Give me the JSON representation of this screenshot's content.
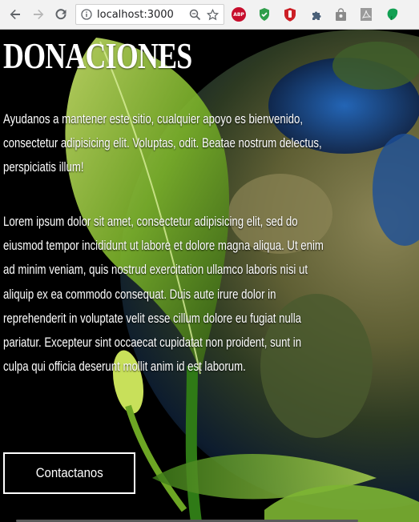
{
  "browser": {
    "url": "localhost:3000",
    "extensions": [
      "abp-icon",
      "shield-icon",
      "ublock-icon",
      "puzzle-icon",
      "bag-icon",
      "pdf-icon",
      "leaf-icon"
    ],
    "abp_label": "ABP"
  },
  "page": {
    "title": "DONACIONES",
    "paragraph1": "Ayudanos a mantener este sitio, cualquier apoyo es bienvenido, consectetur adipisicing elit. Voluptas, odit. Beatae nostrum delectus, perspiciatis illum!",
    "paragraph2": "Lorem ipsum dolor sit amet, consectetur adipisicing elit, sed do eiusmod tempor incididunt ut labore et dolore magna aliqua. Ut enim ad minim veniam, quis nostrud exercitation ullamco laboris nisi ut aliquip ex ea commodo consequat. Duis aute irure dolor in reprehenderit in voluptate velit esse cillum dolore eu fugiat nulla pariatur. Excepteur sint occaecat cupidatat non proident, sunt in culpa qui officia deserunt mollit anim id est laborum.",
    "button_label": "Contactanos"
  },
  "colors": {
    "background": "#000000",
    "text": "#ffffff",
    "leaf": "#7fbf2a",
    "ocean": "#123a7a",
    "land": "#6b6a3a"
  }
}
